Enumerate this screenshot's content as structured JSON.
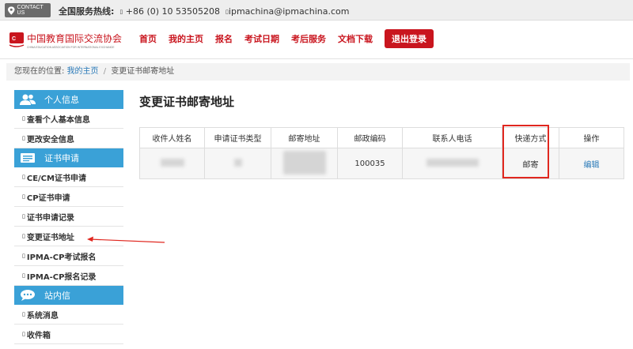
{
  "topbar": {
    "contact_label": "CONTACT US",
    "hotline_label": "全国服务热线:",
    "phone_bullet": "▯",
    "phone": "+86 (0) 10 53505208",
    "email_bullet": "▯",
    "email": "ipmachina@ipmachina.com"
  },
  "nav": {
    "logo_text": "中国教育国际交流协会",
    "logo_subtext": "CHINA EDUCATION ASSOCIATION FOR INTERNATIONAL EXCHANGE",
    "items": [
      "首页",
      "我的主页",
      "报名",
      "考试日期",
      "考后服务",
      "文档下载"
    ],
    "logout": "退出登录"
  },
  "breadcrumb": {
    "prefix": "您现在的位置:",
    "home": "我的主页",
    "separator": "/",
    "current": "变更证书邮寄地址"
  },
  "sidebar": {
    "bullet": "▯",
    "sections": [
      {
        "title": "个人信息",
        "icon": "users-icon",
        "items": [
          "查看个人基本信息",
          "更改安全信息"
        ]
      },
      {
        "title": "证书申请",
        "icon": "certificate-icon",
        "items": [
          "CE/CM证书申请",
          "CP证书申请",
          "证书申请记录",
          "变更证书地址",
          "IPMA-CP考试报名",
          "IPMA-CP报名记录"
        ]
      },
      {
        "title": "站内信",
        "icon": "chat-icon",
        "items": [
          "系统消息",
          "收件箱"
        ]
      }
    ]
  },
  "main": {
    "title": "变更证书邮寄地址",
    "table": {
      "headers": [
        "收件人姓名",
        "申请证书类型",
        "邮寄地址",
        "邮政编码",
        "联系人电话",
        "快递方式",
        "操作"
      ],
      "row": {
        "postcode": "100035",
        "delivery": "邮寄",
        "action": "编辑"
      }
    }
  },
  "colors": {
    "brand_red": "#c9151e",
    "sidebar_blue": "#3aa1d7",
    "link_blue": "#2a7ab8",
    "highlight_red": "#e0271f"
  }
}
